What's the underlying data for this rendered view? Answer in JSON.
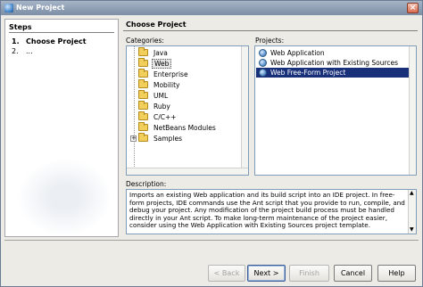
{
  "window": {
    "title": "New Project"
  },
  "steps": {
    "heading": "Steps",
    "items": [
      {
        "num": "1.",
        "label": "Choose Project"
      },
      {
        "num": "2.",
        "label": "..."
      }
    ]
  },
  "main": {
    "heading": "Choose Project",
    "categories_label": "Categories:",
    "projects_label": "Projects:",
    "description_label": "Description:"
  },
  "categories": [
    {
      "label": "Java"
    },
    {
      "label": "Web",
      "selected": true
    },
    {
      "label": "Enterprise"
    },
    {
      "label": "Mobility"
    },
    {
      "label": "UML"
    },
    {
      "label": "Ruby"
    },
    {
      "label": "C/C++"
    },
    {
      "label": "NetBeans Modules"
    },
    {
      "label": "Samples",
      "expander": "+"
    }
  ],
  "projects": [
    {
      "label": "Web Application"
    },
    {
      "label": "Web Application with Existing Sources"
    },
    {
      "label": "Web Free-Form Project",
      "selected": true
    }
  ],
  "description": "Imports an existing Web application and its build script into an IDE project. In free-form projects, IDE commands use the Ant script that you provide to run, compile, and debug your project. Any modification of the project build process must be handled directly in your Ant script. To make long-term maintenance of the project easier, consider using the Web Application with Existing Sources project template.",
  "buttons": {
    "back": "< Back",
    "next": "Next >",
    "finish": "Finish",
    "cancel": "Cancel",
    "help": "Help"
  },
  "colors": {
    "selection": "#18307a",
    "title_gradient": "#8c9db3"
  }
}
